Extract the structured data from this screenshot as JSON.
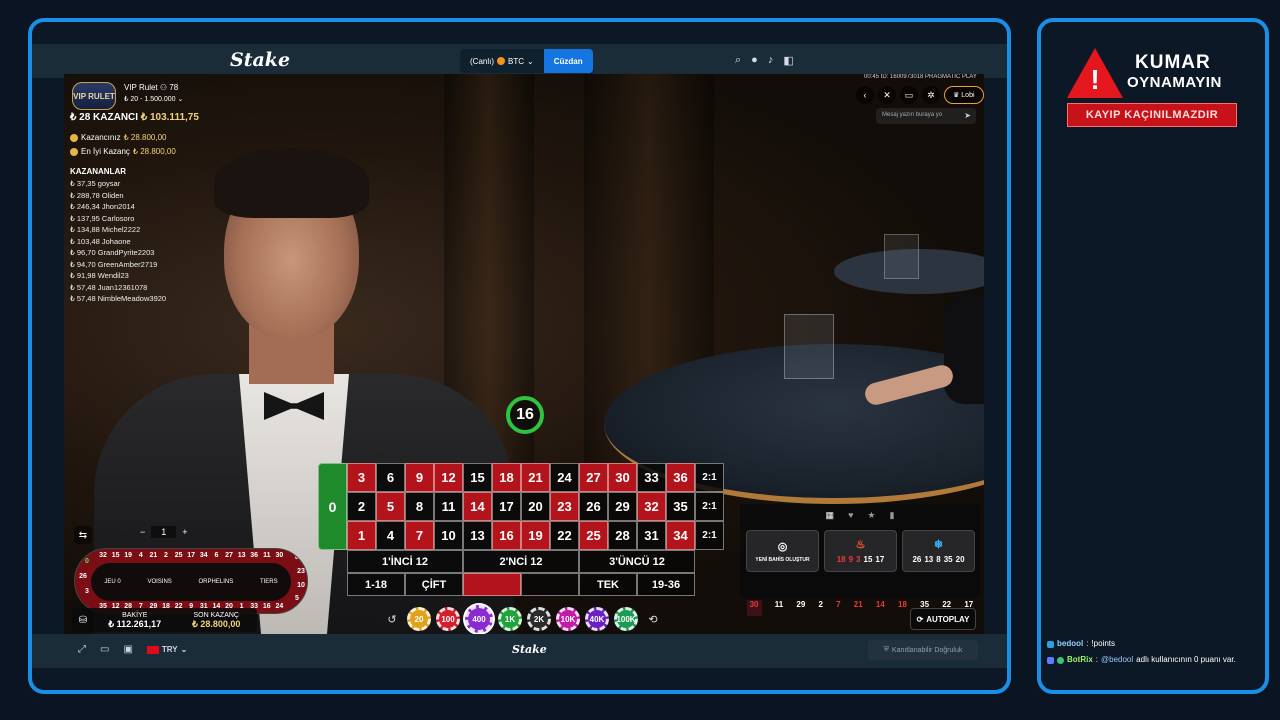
{
  "header": {
    "logo": "Stake",
    "wallet_label": "(Canlı)",
    "currency": "BTC",
    "wallet_button": "Cüzdan"
  },
  "game": {
    "vip_badge": "VIP RULET",
    "table_name": "VIP Rulet",
    "player_count": "78",
    "limits": "20 - 1.500.000",
    "winners_count": "28 KAZANCI",
    "winners_total": "103.111,75",
    "your_win_label": "Kazancınız",
    "your_win_value": "28.800,00",
    "best_win_label": "En İyi Kazanç",
    "best_win_value": "28.800,00",
    "winners_title": "KAZANANLAR",
    "winners": [
      "37,35 goysar",
      "288,78 Oliden",
      "246,34 Jhon2014",
      "137,95 Carlosoro",
      "134,88 Michel2222",
      "103,48 Johaone",
      "96,70 GrandPyrite2203",
      "94,70 GreenAmber2719",
      "91,98 Wendil23",
      "57,48 Juan12361078",
      "57,48 NimbleMeadow3920"
    ],
    "round_info": "00:45 ID: 1600973018 PRAGMATIC PLAY",
    "lobby_button": "Lobi",
    "chat_placeholder": "Mesaj yazın buraya yo",
    "timer": "16"
  },
  "roulette": {
    "zero": "0",
    "rows": [
      [
        "3",
        "6",
        "9",
        "12",
        "15",
        "18",
        "21",
        "24",
        "27",
        "30",
        "33",
        "36",
        "2:1"
      ],
      [
        "2",
        "5",
        "8",
        "11",
        "14",
        "17",
        "20",
        "23",
        "26",
        "29",
        "32",
        "35",
        "2:1"
      ],
      [
        "1",
        "4",
        "7",
        "10",
        "13",
        "16",
        "19",
        "22",
        "25",
        "28",
        "31",
        "34",
        "2:1"
      ]
    ],
    "dozens": [
      "1'İNCİ 12",
      "2'NCİ 12",
      "3'ÜNCÜ 12"
    ],
    "outside": [
      "1-18",
      "ÇİFT",
      "",
      "",
      "TEK",
      "19-36"
    ]
  },
  "racetrack": {
    "neighbours": "1",
    "sections": [
      "JEU 0",
      "VOISINS",
      "ORPHELINS",
      "TIERS"
    ],
    "top": [
      "32",
      "15",
      "19",
      "4",
      "21",
      "2",
      "25",
      "17",
      "34",
      "6",
      "27",
      "13",
      "36",
      "11",
      "30"
    ],
    "bottom": [
      "35",
      "12",
      "28",
      "7",
      "29",
      "18",
      "22",
      "9",
      "31",
      "14",
      "20",
      "1",
      "33",
      "16",
      "24"
    ],
    "left": [
      "0",
      "26",
      "3"
    ],
    "right": [
      "8",
      "23",
      "10",
      "5"
    ]
  },
  "balance": {
    "balance_label": "BAKİYE",
    "balance_value": "112.261,17",
    "win_label": "SON KAZANÇ",
    "win_value": "28.800,00"
  },
  "chips": [
    "20",
    "100",
    "400",
    "1K",
    "2K",
    "10K",
    "40K",
    "100K"
  ],
  "bet_panel": {
    "create_label": "YENİ BAHİS OLUŞTUR",
    "hot": [
      "18",
      "9",
      "3",
      "15",
      "17"
    ],
    "cold": [
      "26",
      "13",
      "8",
      "35",
      "20"
    ],
    "history": [
      "30",
      "11",
      "29",
      "2",
      "7",
      "21",
      "14",
      "18",
      "35",
      "22",
      "17"
    ],
    "autoplay": "AUTOPLAY"
  },
  "footer": {
    "currency": "TRY",
    "logo": "Stake",
    "fair_label": "Kanıtlanabilir Doğruluk"
  },
  "side": {
    "warn_line1": "KUMAR",
    "warn_line2": "OYNAMAYIN",
    "warn_band": "KAYIP KAÇINILMAZDIR",
    "chat": [
      {
        "user": "bedool",
        "message": "!points"
      },
      {
        "user": "BotRix",
        "mention": "@bedool",
        "message": "adlı kullanıcının 0 puanı var."
      }
    ]
  },
  "colors": {
    "frame": "#1a8fe6",
    "red": "#b3141c",
    "green": "#1f8a2b",
    "header": "#1a2c38"
  }
}
